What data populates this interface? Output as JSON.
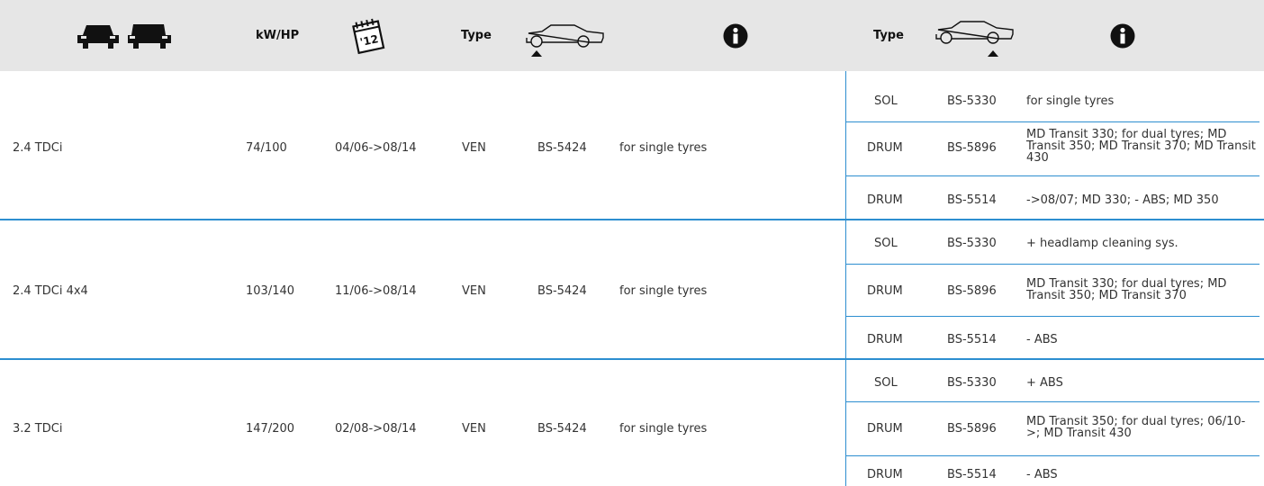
{
  "header": {
    "icons": [
      "vehicle-pair-icon",
      "calendar-icon",
      "car-front-axle-icon",
      "info-icon",
      "car-rear-axle-icon",
      "info-icon"
    ],
    "kwhp_label": "kW/HP",
    "calendar_label": "'12",
    "type_label_left": "Type",
    "type_label_right": "Type"
  },
  "rows": [
    {
      "model": "2.4 TDCi",
      "power": "74/100",
      "period": "04/06->08/14",
      "front_type": "VEN",
      "front_code": "BS-5424",
      "front_note": "for single tyres",
      "rear": [
        {
          "type": "SOL",
          "code": "BS-5330",
          "note": "for single tyres"
        },
        {
          "type": "DRUM",
          "code": "BS-5896",
          "note": "MD Transit 330; for dual tyres; MD Transit 350; MD Transit 370; MD Transit 430"
        },
        {
          "type": "DRUM",
          "code": "BS-5514",
          "note": "->08/07; MD 330; - ABS; MD 350"
        }
      ]
    },
    {
      "model": "2.4 TDCi 4x4",
      "power": "103/140",
      "period": "11/06->08/14",
      "front_type": "VEN",
      "front_code": "BS-5424",
      "front_note": "for single tyres",
      "rear": [
        {
          "type": "SOL",
          "code": "BS-5330",
          "note": "+ headlamp cleaning sys."
        },
        {
          "type": "DRUM",
          "code": "BS-5896",
          "note": "MD Transit 330; for dual tyres; MD Transit 350; MD Transit 370"
        },
        {
          "type": "DRUM",
          "code": "BS-5514",
          "note": "- ABS"
        }
      ]
    },
    {
      "model": "3.2 TDCi",
      "power": "147/200",
      "period": "02/08->08/14",
      "front_type": "VEN",
      "front_code": "BS-5424",
      "front_note": "for single tyres",
      "rear": [
        {
          "type": "SOL",
          "code": "BS-5330",
          "note": "+ ABS"
        },
        {
          "type": "DRUM",
          "code": "BS-5896",
          "note": "MD Transit 350; for dual tyres; 06/10->; MD Transit 430"
        },
        {
          "type": "DRUM",
          "code": "BS-5514",
          "note": "- ABS"
        }
      ]
    }
  ],
  "colors": {
    "accent": "#2d8ed0",
    "header_bg": "#e6e6e6",
    "icon": "#111111"
  }
}
